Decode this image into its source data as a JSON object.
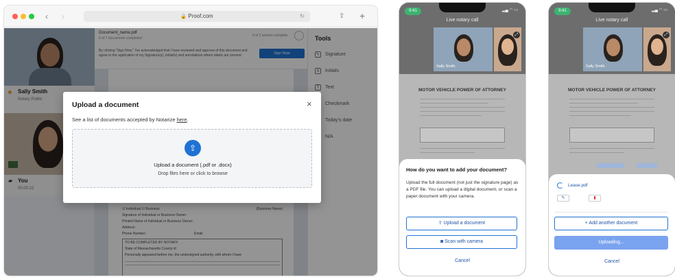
{
  "browser": {
    "url": "Proof.com",
    "sidebar": {
      "participant1": {
        "name": "Sally Smith",
        "role": "Notary Public"
      },
      "participant2": {
        "name": "You",
        "time": "00:00:22"
      }
    },
    "doc_header": {
      "doc_name": "Document_name.pdf",
      "doc_count": "0 of 7 documents completed",
      "actions": "0 of 2 actions complete",
      "notice": "By clicking \"Sign Now,\" I've acknowledged that I have reviewed and approve of this document and agree to the application of my Signature(s), Initial(s) and annotations where labels are present.",
      "sign_now": "Sign Now"
    },
    "tools": {
      "title": "Tools",
      "items": [
        {
          "label": "Signature",
          "glyph": "✎"
        },
        {
          "label": "Initials",
          "glyph": "X"
        },
        {
          "label": "Text",
          "glyph": "T"
        },
        {
          "label": "Checkmark",
          "glyph": "✓"
        },
        {
          "label": "Today's date",
          "glyph": "▦"
        },
        {
          "label": "N/A",
          "glyph": "⊘"
        }
      ]
    },
    "modal": {
      "title": "Upload a document",
      "subtitle": "See a list of documents accepted by Notarize ",
      "subtitle_link": "here",
      "subtitle_end": ".",
      "upload_title": "Upload a document (.pdf or .docx)",
      "upload_sub": "Drop files here or click to browse"
    },
    "doc_form": {
      "individual": "Individual",
      "business": "Business",
      "business_name": "(Business Name)",
      "sig_line": "Signature of Individual or Business Owner:",
      "printed_line": "Printed Name of Individual or Business Owner:",
      "address": "Address:",
      "phone": "Phone Number:",
      "email": "Email",
      "completed_by": "TO BE COMPLETED BY NOTARY:",
      "state_line": "State of Massachusetts County of",
      "personally": "Personally appeared before me, the undersigned authority,",
      "whom": "with whom I have"
    }
  },
  "phone1": {
    "time": "9:41",
    "call_title": "Live notary call",
    "participant": "Sally Smith",
    "doc_title": "MOTOR VEHICLE POWER OF ATTORNEY",
    "sheet": {
      "title": "How do you want to add your document?",
      "body": "Upload the full document (not just the signature page) as a PDF file. You can upload a digital document, or scan a paper document with your camera.",
      "upload_btn": "Upload a document",
      "scan_btn": "Scan with camera",
      "cancel": "Cancel"
    }
  },
  "phone2": {
    "time": "9:41",
    "call_title": "Live notary call",
    "participant": "Sally Smith",
    "doc_title": "MOTOR VEHICLE POWER OF ATTORNEY",
    "sheet": {
      "file_name": "Lease.pdf",
      "add_btn": "Add another document",
      "uploading": "Uploading...",
      "cancel": "Cancel"
    }
  },
  "colors": {
    "accent": "#1f72d3",
    "status_green": "#3cb371",
    "uploading": "#7aa3ef"
  }
}
